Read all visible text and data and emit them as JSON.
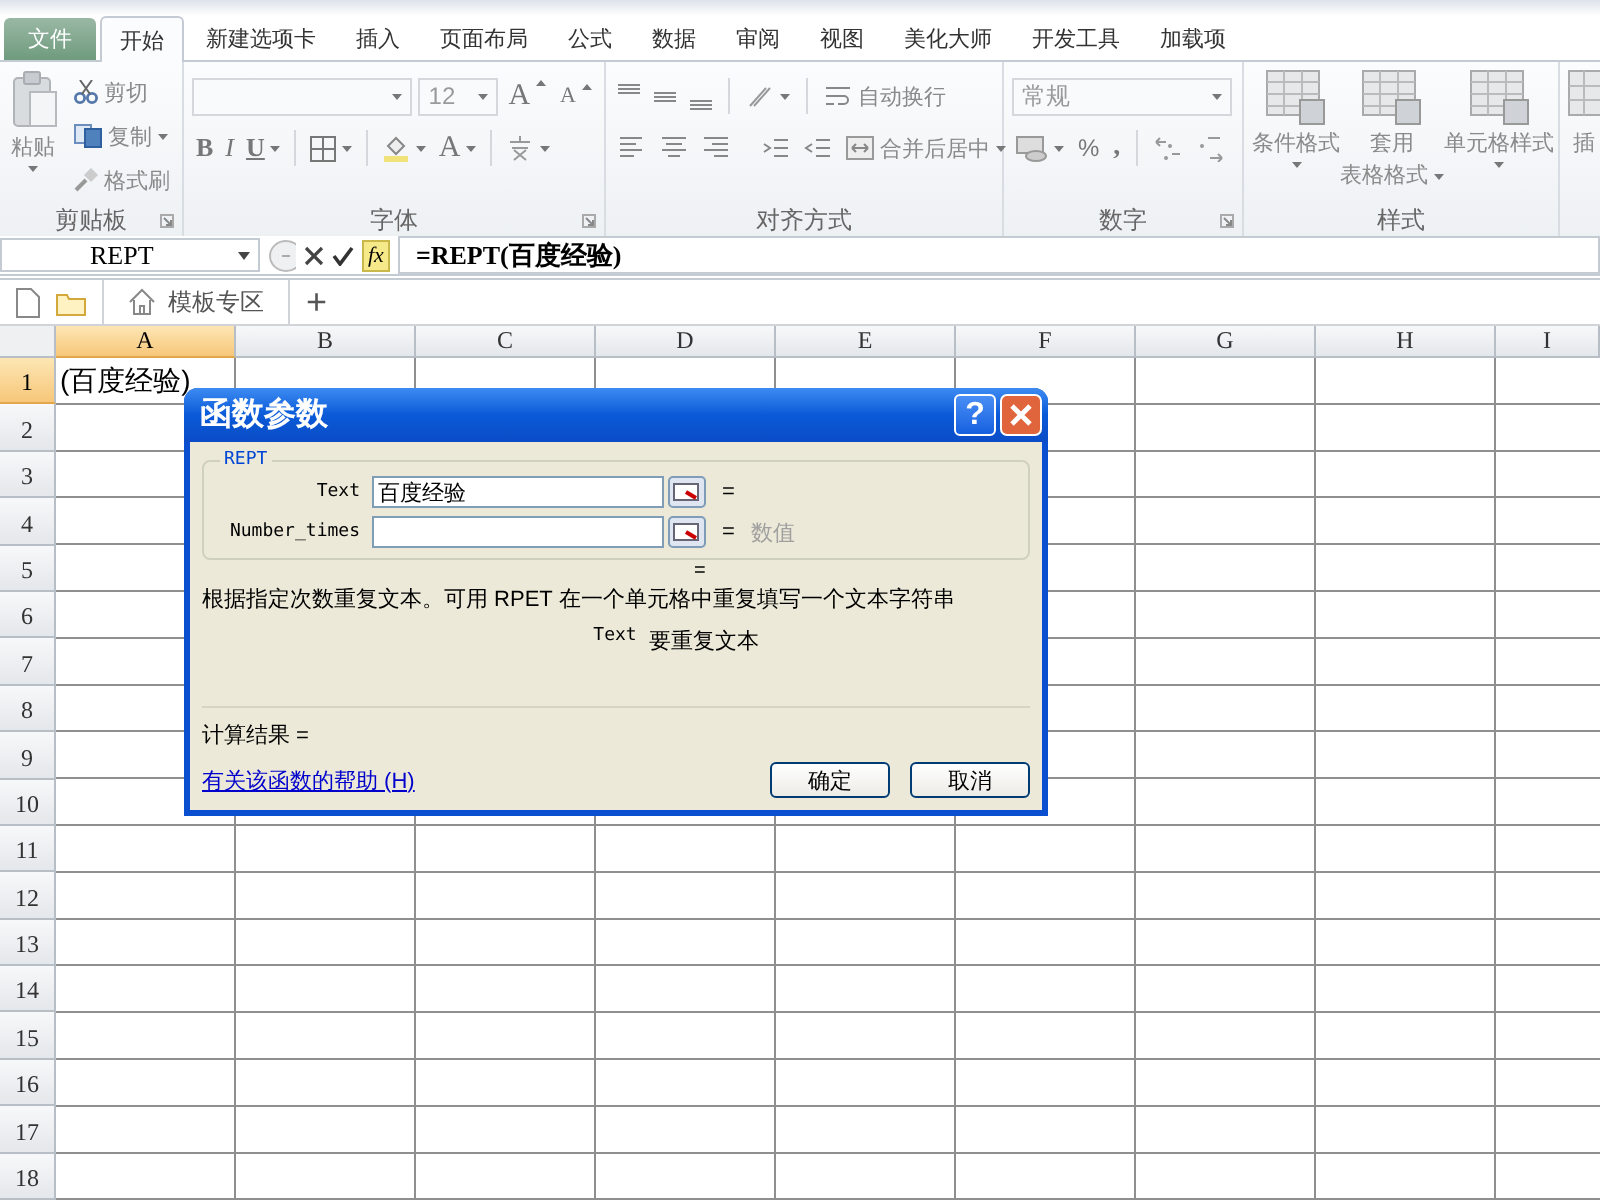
{
  "ribbon_tabs": [
    {
      "label": "文件",
      "kind": "file",
      "selected": false
    },
    {
      "label": "开始",
      "kind": "tab",
      "selected": true
    },
    {
      "label": "新建选项卡",
      "kind": "tab",
      "selected": false
    },
    {
      "label": "插入",
      "kind": "tab",
      "selected": false
    },
    {
      "label": "页面布局",
      "kind": "tab",
      "selected": false
    },
    {
      "label": "公式",
      "kind": "tab",
      "selected": false
    },
    {
      "label": "数据",
      "kind": "tab",
      "selected": false
    },
    {
      "label": "审阅",
      "kind": "tab",
      "selected": false
    },
    {
      "label": "视图",
      "kind": "tab",
      "selected": false
    },
    {
      "label": "美化大师",
      "kind": "tab",
      "selected": false
    },
    {
      "label": "开发工具",
      "kind": "tab",
      "selected": false
    },
    {
      "label": "加载项",
      "kind": "tab",
      "selected": false
    }
  ],
  "clipboard": {
    "title": "剪贴板",
    "paste": "粘贴",
    "cut": "剪切",
    "copy": "复制",
    "format_painter": "格式刷"
  },
  "font": {
    "title": "字体",
    "size": "12",
    "grow": "A",
    "shrink": "A",
    "bold": "B",
    "italic": "I",
    "underline": "U",
    "font_color": "A"
  },
  "alignment": {
    "title": "对齐方式",
    "wrap_text": "自动换行",
    "merge": "合并后居中"
  },
  "number": {
    "title": "数字",
    "format": "常规",
    "percent": "%",
    "comma": ","
  },
  "styles": {
    "title": "样式",
    "conditional": "条件格式",
    "table_format": [
      "套用",
      "表格格式"
    ],
    "cell_styles": "单元格样式"
  },
  "cells_group_partial": "插",
  "name_box": "REPT",
  "fx": "fx",
  "formula": "=REPT(百度经验)",
  "sheet_tabs": [
    {
      "label": "模板专区"
    }
  ],
  "add_tab": "+",
  "columns": [
    {
      "label": "A",
      "selected": true
    },
    {
      "label": "B",
      "selected": false
    },
    {
      "label": "C",
      "selected": false
    },
    {
      "label": "D",
      "selected": false
    },
    {
      "label": "E",
      "selected": false
    },
    {
      "label": "F",
      "selected": false
    },
    {
      "label": "G",
      "selected": false
    },
    {
      "label": "H",
      "selected": false
    },
    {
      "label": "I",
      "selected": false
    }
  ],
  "rows": [
    {
      "label": "1",
      "selected": true,
      "cells": [
        "(百度经验)"
      ]
    },
    {
      "label": "2",
      "selected": false
    },
    {
      "label": "3",
      "selected": false
    },
    {
      "label": "4",
      "selected": false
    },
    {
      "label": "5",
      "selected": false
    },
    {
      "label": "6",
      "selected": false
    },
    {
      "label": "7",
      "selected": false
    },
    {
      "label": "8",
      "selected": false
    },
    {
      "label": "9",
      "selected": false
    },
    {
      "label": "10",
      "selected": false
    },
    {
      "label": "11",
      "selected": false
    },
    {
      "label": "12",
      "selected": false
    },
    {
      "label": "13",
      "selected": false
    },
    {
      "label": "14",
      "selected": false
    },
    {
      "label": "15",
      "selected": false
    },
    {
      "label": "16",
      "selected": false
    },
    {
      "label": "17",
      "selected": false
    },
    {
      "label": "18",
      "selected": false
    }
  ],
  "dialog": {
    "title": "函数参数",
    "help": "?",
    "function": "REPT",
    "arguments": [
      {
        "name": "Text",
        "value": "百度经验",
        "equals": "="
      },
      {
        "name": "Number_times",
        "equals": "=",
        "type_hint": "数值"
      }
    ],
    "formula_equals": "=",
    "description": "根据指定次数重复文本。可用 RPET 在一个单元格中重复填写一个文本字符串",
    "argument_help": {
      "name": "Text",
      "text": "要重复文本"
    },
    "result_label": "计算结果 =",
    "help_link": "有关该函数的帮助 (H)",
    "buttons": [
      "确定",
      "取消"
    ]
  }
}
